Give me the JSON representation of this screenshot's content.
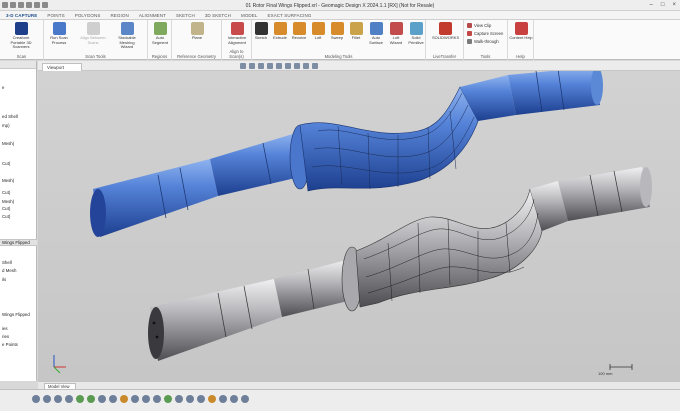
{
  "window": {
    "title": "01 Rotor Final Wings Flipped.xrl - Geomagic Design X 2024.1.1 [RX] (Not for Resale)"
  },
  "menu_tabs": [
    "3-D CAPTURE",
    "POINTS",
    "POLYGONS",
    "REGION",
    "ALIGNMENT",
    "SKETCH",
    "3D SKETCH",
    "MODEL",
    "EXACT SURFACING"
  ],
  "active_tab_index": 0,
  "ribbon": {
    "groups": [
      {
        "name": "Scan",
        "buttons": [
          "Creaform Portable 3D Scanners"
        ]
      },
      {
        "name": "Scan Tools",
        "buttons": [
          "Run Scan Process",
          "Align Between Scans",
          "Stockable Meshing Wizard"
        ]
      },
      {
        "name": "Regions",
        "buttons": [
          "Auto Segment"
        ]
      },
      {
        "name": "Reference Geometry",
        "buttons": [
          "Plane"
        ]
      },
      {
        "name": "Align to Scan(s)",
        "buttons": [
          "Interactive Alignment"
        ]
      },
      {
        "name": "Modeling Tools",
        "buttons": [
          "Sketch",
          "Extrude",
          "Revolve",
          "Loft",
          "Sweep",
          "Fillet",
          "Auto Surface",
          "Loft Wizard",
          "Solid Primitive"
        ]
      },
      {
        "name": "LiveTransfer",
        "buttons": [
          "SOLIDWORKS"
        ]
      },
      {
        "name": "Tools",
        "buttons": [
          "View Clip",
          "Capture Screen",
          "Walk-through"
        ]
      },
      {
        "name": "Help",
        "buttons": [
          "Content Help"
        ]
      }
    ]
  },
  "left_panel": {
    "tree_tab": "Viewport",
    "items_top": [
      "e",
      "ed Shell",
      "mp)",
      "Mesh)",
      "Cut)",
      "Mesh)",
      "Cut)",
      "Mesh)",
      "Cut)",
      "Cut)"
    ],
    "section_title": "Wings Flipped",
    "items_bottom": [
      "Shell",
      "d Mesh",
      "ils",
      "Wings Flipped",
      "ies",
      "ries",
      "e Points"
    ]
  },
  "viewport": {
    "tab_label": "Viewport",
    "scale_label": "100 mm",
    "model_colors": {
      "blue": "#3f6fd0",
      "gray": "#a9a9ad",
      "mesh": "#1e2a44"
    }
  },
  "bottom": {
    "tab_label": "Model View"
  }
}
